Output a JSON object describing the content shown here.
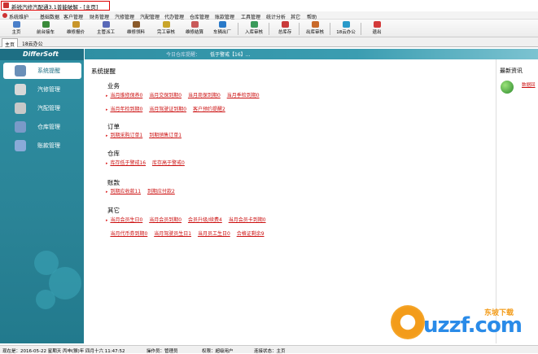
{
  "window": {
    "title": "新锐汽修汽配通3.1普能破解 - [主页]"
  },
  "menu": [
    "系统维护",
    "基础数据",
    "客户管理",
    "财务管理",
    "汽修管理",
    "汽配管理",
    "代办管理",
    "仓库管理",
    "账款管理",
    "工具管理",
    "统计分析",
    "其它",
    "帮助"
  ],
  "toolbar": [
    {
      "label": "主页",
      "icon": "home-icon",
      "color": "#4a7fc9"
    },
    {
      "label": "前台接车",
      "icon": "car-icon",
      "color": "#3a8a3a"
    },
    {
      "label": "维修报价",
      "icon": "quote-icon",
      "color": "#c9962a"
    },
    {
      "label": "主管派工",
      "icon": "dispatch-icon",
      "color": "#5a6ab8"
    },
    {
      "label": "维修领料",
      "icon": "parts-icon",
      "color": "#8a5a2a"
    },
    {
      "label": "完工审核",
      "icon": "audit-icon",
      "color": "#c9a52a"
    },
    {
      "label": "维修结算",
      "icon": "settle-icon",
      "color": "#c95a5a"
    },
    {
      "label": "车辆出厂",
      "icon": "exit-icon",
      "color": "#2a7ac9"
    },
    {
      "label": "入库审核",
      "icon": "stock-in-icon",
      "color": "#3a9a5a"
    },
    {
      "label": "总库存",
      "icon": "inventory-icon",
      "color": "#c93a3a"
    },
    {
      "label": "出库审核",
      "icon": "stock-out-icon",
      "color": "#c96a2a"
    },
    {
      "label": "18云办公",
      "icon": "cloud-icon",
      "color": "#2a9ac9"
    },
    {
      "label": "退出",
      "icon": "exit-power-icon",
      "color": "#d33a3a"
    }
  ],
  "tabs": [
    "主页",
    "18云办公"
  ],
  "sidebar": {
    "logo": "DifferSoft",
    "items": [
      "系统提醒",
      "汽修管理",
      "汽配管理",
      "仓库管理",
      "账款管理"
    ]
  },
  "topstrip": {
    "date_label": "今日仓库提醒：",
    "alert": "低于警戒【16】..."
  },
  "main": {
    "heading": "系统提醒",
    "sections": [
      {
        "title": "业务",
        "rows": [
          [
            "当月维修保养0",
            "当月交保到期0",
            "当月商保到期0",
            "当月季检到期0"
          ],
          [
            "当月年检到期0",
            "当月驾驶证到期0",
            "客户预约提醒2"
          ]
        ]
      },
      {
        "title": "订单",
        "rows": [
          [
            "到期采购订单1",
            "到期销售订单1"
          ]
        ]
      },
      {
        "title": "仓库",
        "rows": [
          [
            "库存低于警戒16",
            "库存高于警戒0"
          ]
        ]
      },
      {
        "title": "账款",
        "rows": [
          [
            "到期应收款11",
            "到期应付款2"
          ]
        ]
      },
      {
        "title": "其它",
        "rows": [
          [
            "当月会员生日0",
            "当月会员到期0",
            "会员升级/续费4",
            "当月会员卡到期0"
          ],
          [
            "当月代币券到期0",
            "当月驾驶员生日1",
            "当月员工生日0",
            "合格证剩余9"
          ]
        ]
      }
    ]
  },
  "news": {
    "title": "最新资讯",
    "link": "数据回"
  },
  "watermark": {
    "text": "uzzf.com",
    "sub": "东坡下载"
  },
  "status": {
    "time": "现在是：2016-05-22 星期天 丙申(猴)年 四月十六 11:47:52",
    "operator": "操作员：管理员",
    "permission": "权限：超级用户",
    "connection": "连接状态：主页"
  }
}
